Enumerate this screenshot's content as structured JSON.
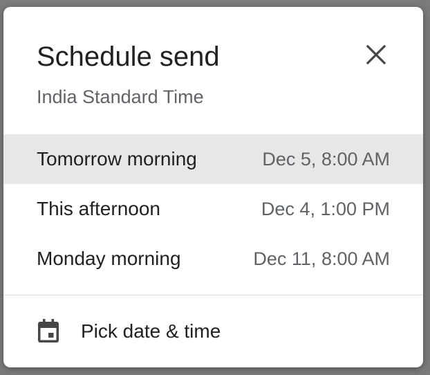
{
  "dialog": {
    "title": "Schedule send",
    "timezone": "India Standard Time",
    "close_icon": "close-icon",
    "options": [
      {
        "label": "Tomorrow morning",
        "time": "Dec 5, 8:00 AM",
        "selected": true
      },
      {
        "label": "This afternoon",
        "time": "Dec 4, 1:00 PM",
        "selected": false
      },
      {
        "label": "Monday morning",
        "time": "Dec 11, 8:00 AM",
        "selected": false
      }
    ],
    "pick": {
      "icon": "calendar-icon",
      "label": "Pick date & time"
    }
  },
  "colors": {
    "selected_bg": "#e6e7e6",
    "text_primary": "#202124",
    "text_secondary": "#5f6368"
  }
}
